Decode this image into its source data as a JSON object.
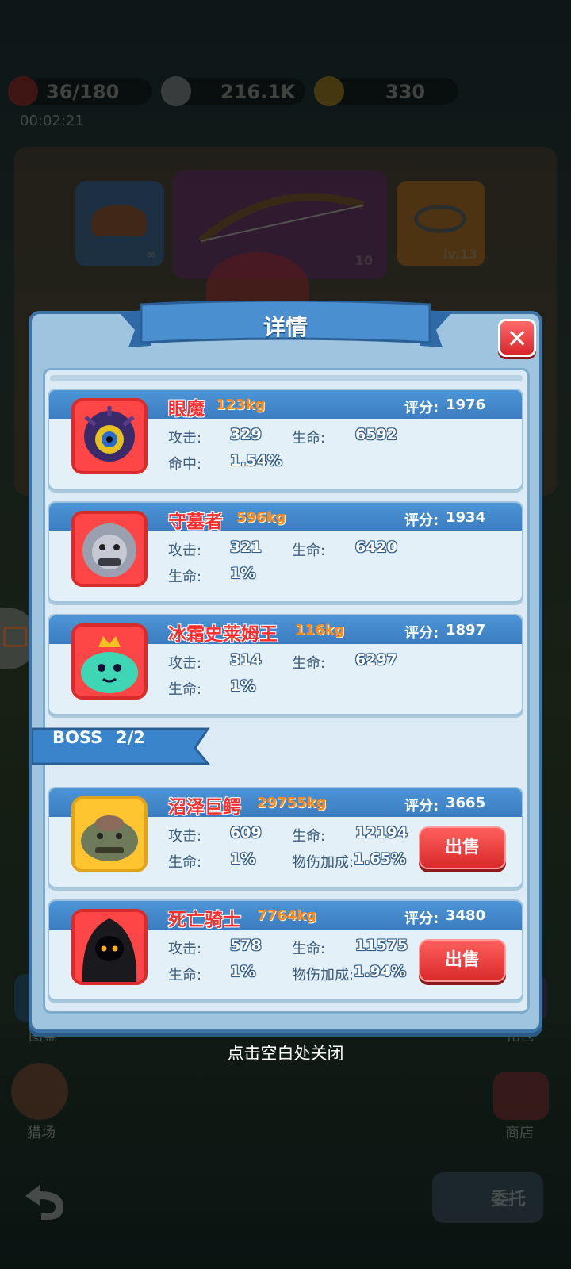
{
  "hud": {
    "resource_1": "36/180",
    "resource_2": "216.1K",
    "resource_3": "330",
    "timer": "00:02:21"
  },
  "background": {
    "slot_hat_count": "∞",
    "slot_bow_count": "10",
    "slot_ring_level": "lv.13",
    "left_label_1": "图鉴",
    "left_label_2": "猎场",
    "right_label_1": "礼包",
    "right_label_2": "商店",
    "bottom_button": "委托"
  },
  "dialog": {
    "title": "详情",
    "close_label": "✕",
    "hint": "点击空白处关闭",
    "boss_label": "BOSS",
    "boss_count": "2/2"
  },
  "monsters": [
    {
      "name": "眼魔",
      "weight": "123kg",
      "score_label": "评分:",
      "score": "1976",
      "stat1_label": "攻击:",
      "stat1_value": "329",
      "stat2_label": "生命:",
      "stat2_value": "6592",
      "stat3_label": "命中:",
      "stat3_value": "1.54%"
    },
    {
      "name": "守墓者",
      "weight": "596kg",
      "score_label": "评分:",
      "score": "1934",
      "stat1_label": "攻击:",
      "stat1_value": "321",
      "stat2_label": "生命:",
      "stat2_value": "6420",
      "stat3_label": "生命:",
      "stat3_value": "1%"
    },
    {
      "name": "冰霜史莱姆王",
      "weight": "116kg",
      "score_label": "评分:",
      "score": "1897",
      "stat1_label": "攻击:",
      "stat1_value": "314",
      "stat2_label": "生命:",
      "stat2_value": "6297",
      "stat3_label": "生命:",
      "stat3_value": "1%"
    }
  ],
  "bosses": [
    {
      "name": "沼泽巨鳄",
      "weight": "29755kg",
      "score_label": "评分:",
      "score": "3665",
      "stat1_label": "攻击:",
      "stat1_value": "609",
      "stat2_label": "生命:",
      "stat2_value": "12194",
      "stat3_label": "生命:",
      "stat3_value": "1%",
      "stat4_label": "物伤加成:",
      "stat4_value": "1.65%",
      "sell_label": "出售"
    },
    {
      "name": "死亡骑士",
      "weight": "7764kg",
      "score_label": "评分:",
      "score": "3480",
      "stat1_label": "攻击:",
      "stat1_value": "578",
      "stat2_label": "生命:",
      "stat2_value": "11575",
      "stat3_label": "生命:",
      "stat3_value": "1%",
      "stat4_label": "物伤加成:",
      "stat4_value": "1.94%",
      "sell_label": "出售"
    }
  ]
}
